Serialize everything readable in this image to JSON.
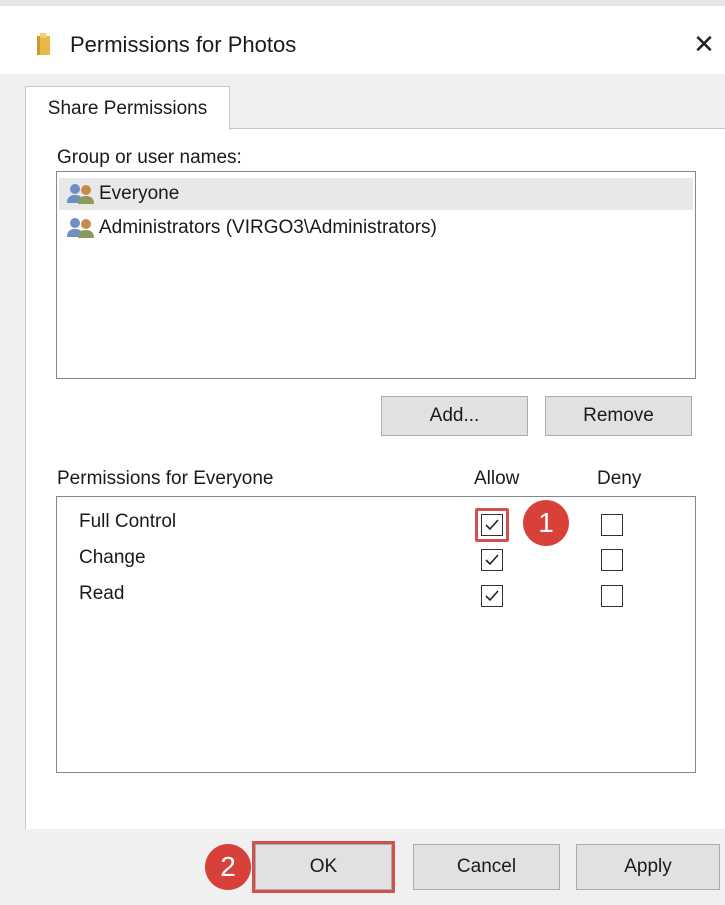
{
  "window": {
    "title": "Permissions for Photos",
    "close_glyph": "✕"
  },
  "tabs": [
    {
      "label": "Share Permissions",
      "active": true
    }
  ],
  "users": {
    "label": "Group or user names:",
    "items": [
      {
        "name": "Everyone",
        "icon": "users-icon",
        "selected": true
      },
      {
        "name": "Administrators (VIRGO3\\Administrators)",
        "icon": "users-icon",
        "selected": false
      }
    ],
    "add_label": "Add...",
    "remove_label": "Remove"
  },
  "permissions": {
    "header": "Permissions for Everyone",
    "allow_header": "Allow",
    "deny_header": "Deny",
    "rows": [
      {
        "name": "Full Control",
        "allow": true,
        "deny": false
      },
      {
        "name": "Change",
        "allow": true,
        "deny": false
      },
      {
        "name": "Read",
        "allow": true,
        "deny": false
      }
    ]
  },
  "buttons": {
    "ok": "OK",
    "cancel": "Cancel",
    "apply": "Apply"
  },
  "annotations": {
    "step1": "1",
    "step2": "2",
    "highlight_color": "#d0524d",
    "badge_color": "#d8403a"
  }
}
